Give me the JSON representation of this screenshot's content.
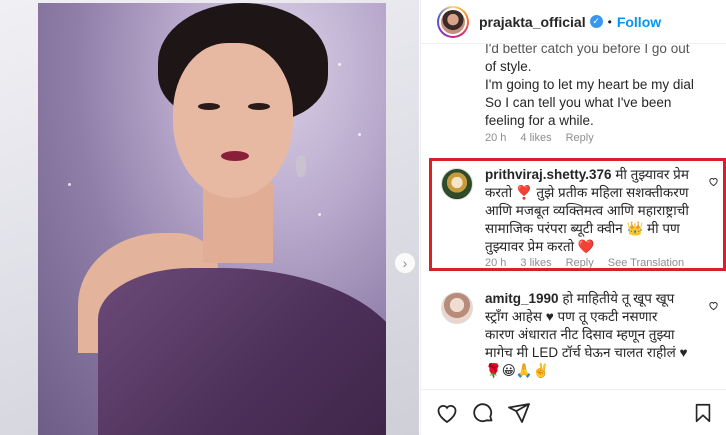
{
  "post": {
    "username": "prajakta_official",
    "separator": "•",
    "follow_label": "Follow"
  },
  "comments": [
    {
      "text_lines": [
        "I'd better catch you before I go out",
        "of style.",
        "I'm going to let my heart be my dial",
        "So I can tell you what I've been",
        "feeling for a while."
      ],
      "time": "20 h",
      "likes": "4 likes",
      "reply": "Reply"
    },
    {
      "username": "prithviraj.shetty.376",
      "text_first": "मी तुझ्यावर प्रेम",
      "text_lines": [
        "करतो ❣️ तुझे प्रतीक महिला सशक्तीकरण",
        "आणि मजबूत व्यक्तिमत्व आणि महाराष्ट्राची",
        "सामाजिक परंपरा ब्यूटी क्वीन 👑 मी पण",
        "तुझ्यावर प्रेम करतो ❤️"
      ],
      "time": "20 h",
      "likes": "3 likes",
      "reply": "Reply",
      "translation": "See Translation",
      "highlighted": true
    },
    {
      "username": "amitg_1990",
      "text_first": "हो माहितीये तू खूप खूप",
      "text_lines": [
        "स्ट्रॉंग आहेस ♥ पण तू एकटी नसणार",
        "कारण अंधारात नीट दिसाव म्हणून तुझ्या",
        "मागेच मी LED टॉर्च घेऊन चालत राहीलं ♥",
        "🌹😀🙏✌️"
      ]
    }
  ],
  "colors": {
    "accent": "#0095f6",
    "highlight_border": "#d81f2a",
    "verified": "#3897f0",
    "muted": "#8e8e8e"
  },
  "icons": [
    "verified-badge-icon",
    "heart-icon",
    "comment-icon",
    "share-icon",
    "bookmark-icon",
    "chevron-right-icon"
  ]
}
